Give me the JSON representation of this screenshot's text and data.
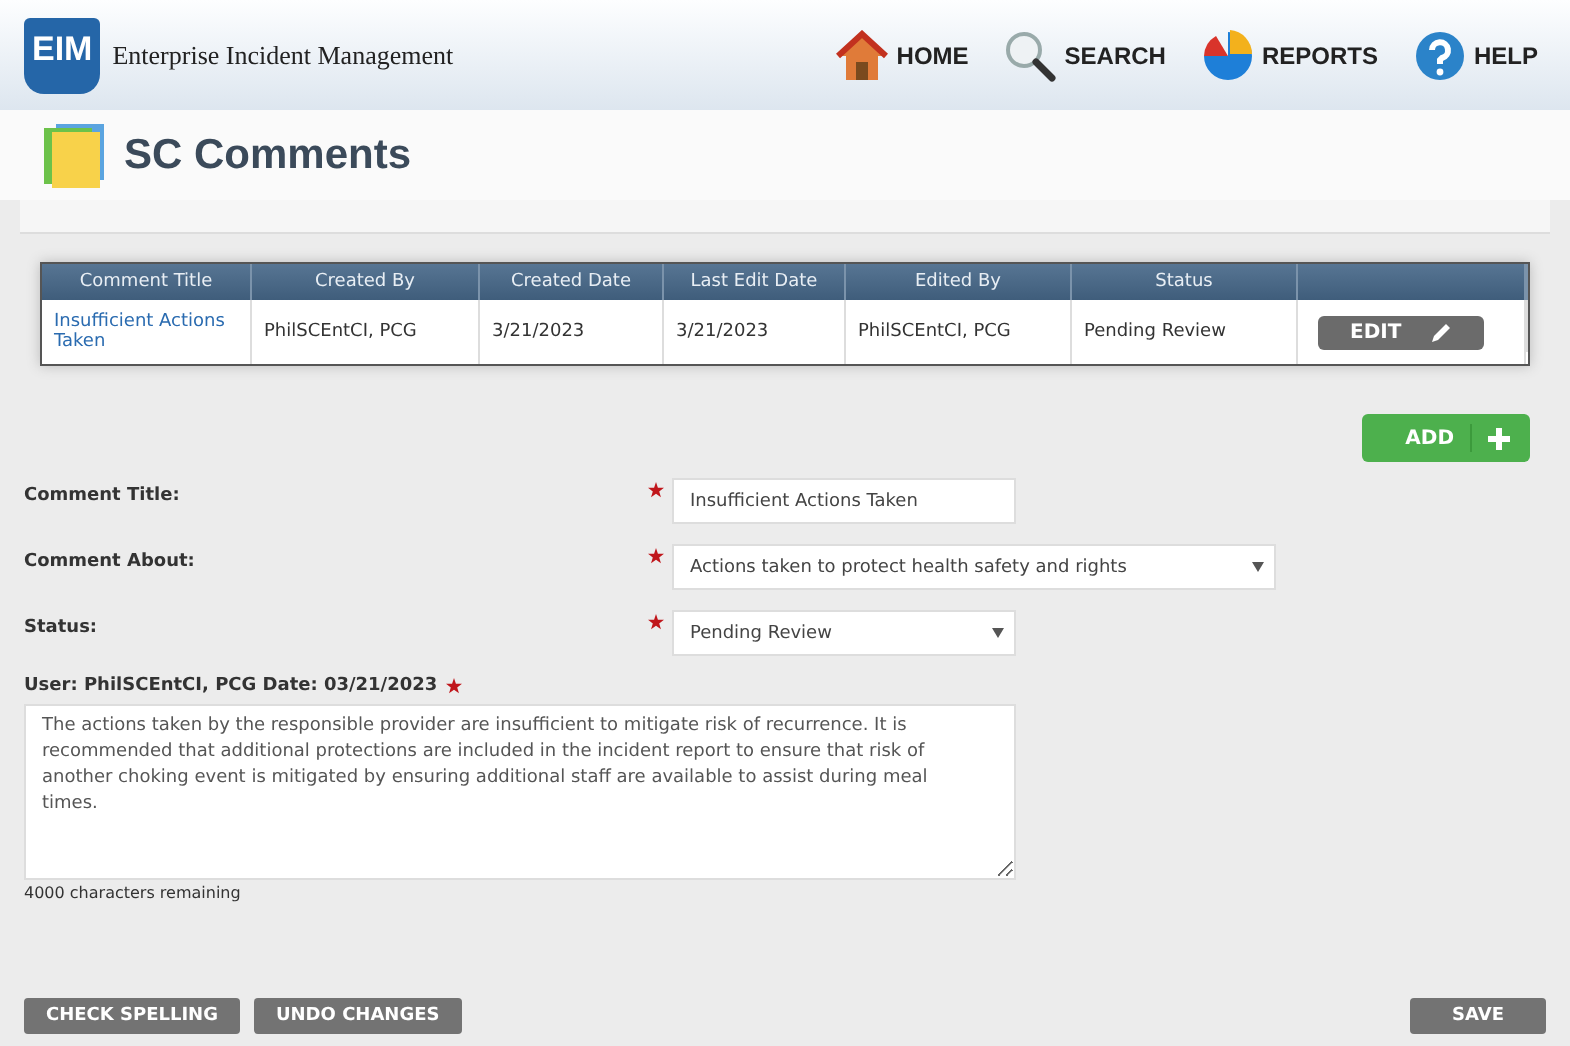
{
  "header": {
    "logo_text": "EIM",
    "app_name": "Enterprise Incident Management",
    "nav": [
      {
        "label": "HOME"
      },
      {
        "label": "SEARCH"
      },
      {
        "label": "REPORTS"
      },
      {
        "label": "HELP"
      }
    ]
  },
  "page_title": "SC Comments",
  "table": {
    "columns": [
      "Comment Title",
      "Created By",
      "Created Date",
      "Last Edit Date",
      "Edited By",
      "Status"
    ],
    "rows": [
      {
        "cells": [
          "Insufficient Actions Taken",
          "PhilSCEntCI, PCG",
          "3/21/2023",
          "3/21/2023",
          "PhilSCEntCI, PCG",
          "Pending Review"
        ],
        "action": "EDIT"
      }
    ]
  },
  "add_button": "ADD",
  "form": {
    "fields": [
      {
        "label": "Comment Title:",
        "kind": "text",
        "value": "Insufficient Actions Taken",
        "required": true
      },
      {
        "label": "Comment About:",
        "kind": "select",
        "value": "Actions taken to protect health safety and rights",
        "required": true
      },
      {
        "label": "Status:",
        "kind": "select",
        "value": "Pending Review",
        "required": true
      }
    ],
    "comment_label": "User: PhilSCEntCI, PCG Date: 03/21/2023",
    "comment_required": true,
    "comment": "The actions taken by the responsible provider are insufficient to mitigate risk of recurrence. It is recommended that additional protections are included in the incident report to ensure that risk of another choking event is mitigated by ensuring additional staff are available to assist during meal times.",
    "remaining": "4000 characters remaining"
  },
  "footer_buttons": [
    {
      "label": "CHECK SPELLING"
    },
    {
      "label": "UNDO CHANGES"
    },
    {
      "label": "SAVE"
    }
  ]
}
